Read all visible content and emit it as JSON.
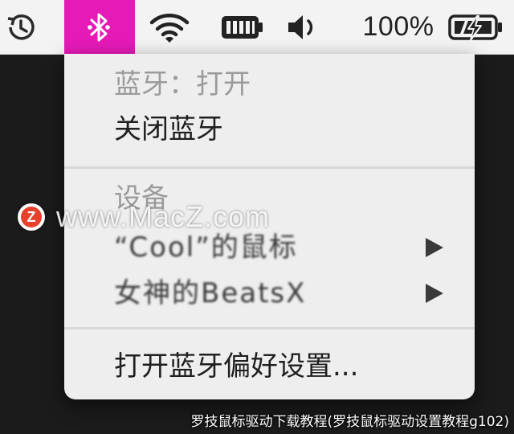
{
  "menubar": {
    "icons": [
      "history-icon",
      "bluetooth-icon",
      "wifi-icon",
      "battery-app-icon",
      "volume-icon",
      "battery-charging-icon"
    ],
    "battery_percent": "100%",
    "highlight_color": "#e51ab7"
  },
  "bluetooth_menu": {
    "status": "蓝牙：打开",
    "toggle_action": "关闭蓝牙",
    "devices_header": "设备",
    "devices": [
      {
        "label": "“Cool”的鼠标"
      },
      {
        "label": "女神的BeatsX"
      }
    ],
    "open_preferences": "打开蓝牙偏好设置..."
  },
  "watermark": {
    "logo_letter": "Z",
    "text": "www.MacZ.com"
  },
  "caption": "罗技鼠标驱动下载教程(罗技鼠标驱动设置教程g102)"
}
